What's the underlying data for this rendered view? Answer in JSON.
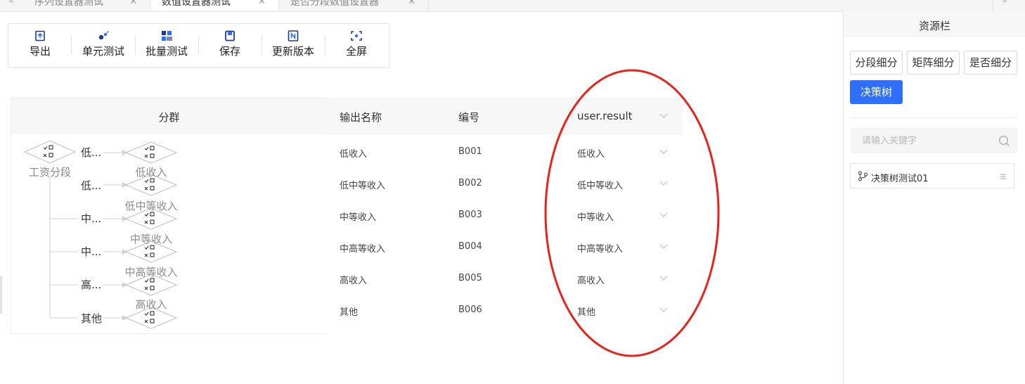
{
  "tabs": [
    {
      "label": "序列设置器测试",
      "active": false
    },
    {
      "label": "数值设置器测试",
      "active": true
    },
    {
      "label": "是否分段数值设置器",
      "active": false
    }
  ],
  "toolbar": {
    "export": "导出",
    "unit_test": "单元测试",
    "batch_test": "批量测试",
    "save": "保存",
    "update_version": "更新版本",
    "fullscreen": "全屏"
  },
  "tree": {
    "header": "分群",
    "root_label": "工资分段",
    "branches": [
      {
        "condition": "低...",
        "leaf": "低收入"
      },
      {
        "condition": "低...",
        "leaf": "低中等收入"
      },
      {
        "condition": "中...",
        "leaf": "中等收入"
      },
      {
        "condition": "中...",
        "leaf": "中高等收入"
      },
      {
        "condition": "高...",
        "leaf": "高收入"
      },
      {
        "condition": "其他",
        "leaf": ""
      }
    ]
  },
  "table": {
    "headers": {
      "output_name": "输出名称",
      "code": "编号",
      "result_field": "user.result"
    },
    "rows": [
      {
        "name": "低收入",
        "code": "B001",
        "value": "低收入"
      },
      {
        "name": "低中等收入",
        "code": "B002",
        "value": "低中等收入"
      },
      {
        "name": "中等收入",
        "code": "B003",
        "value": "中等收入"
      },
      {
        "name": "中高等收入",
        "code": "B004",
        "value": "中高等收入"
      },
      {
        "name": "高收入",
        "code": "B005",
        "value": "高收入"
      },
      {
        "name": "其他",
        "code": "B006",
        "value": "其他"
      }
    ]
  },
  "sidebar": {
    "title": "资源栏",
    "chips": [
      "分段细分",
      "矩阵细分",
      "是否细分",
      "决策树"
    ],
    "search_placeholder": "请输入关键字",
    "items": [
      {
        "label": "决策树测试01"
      }
    ]
  },
  "colors": {
    "primary": "#2f6fff",
    "annotation": "#e8231c",
    "node_stroke": "#bfbfbf"
  },
  "icons": {
    "export": "export-icon",
    "unit_test": "unit-test-icon",
    "batch_test": "batch-test-icon",
    "save": "save-icon",
    "update_version": "version-icon",
    "fullscreen": "fullscreen-icon",
    "node": "decision-node-icon",
    "search": "search-icon",
    "tree_item": "branch-icon",
    "drag": "drag-handle-icon"
  }
}
